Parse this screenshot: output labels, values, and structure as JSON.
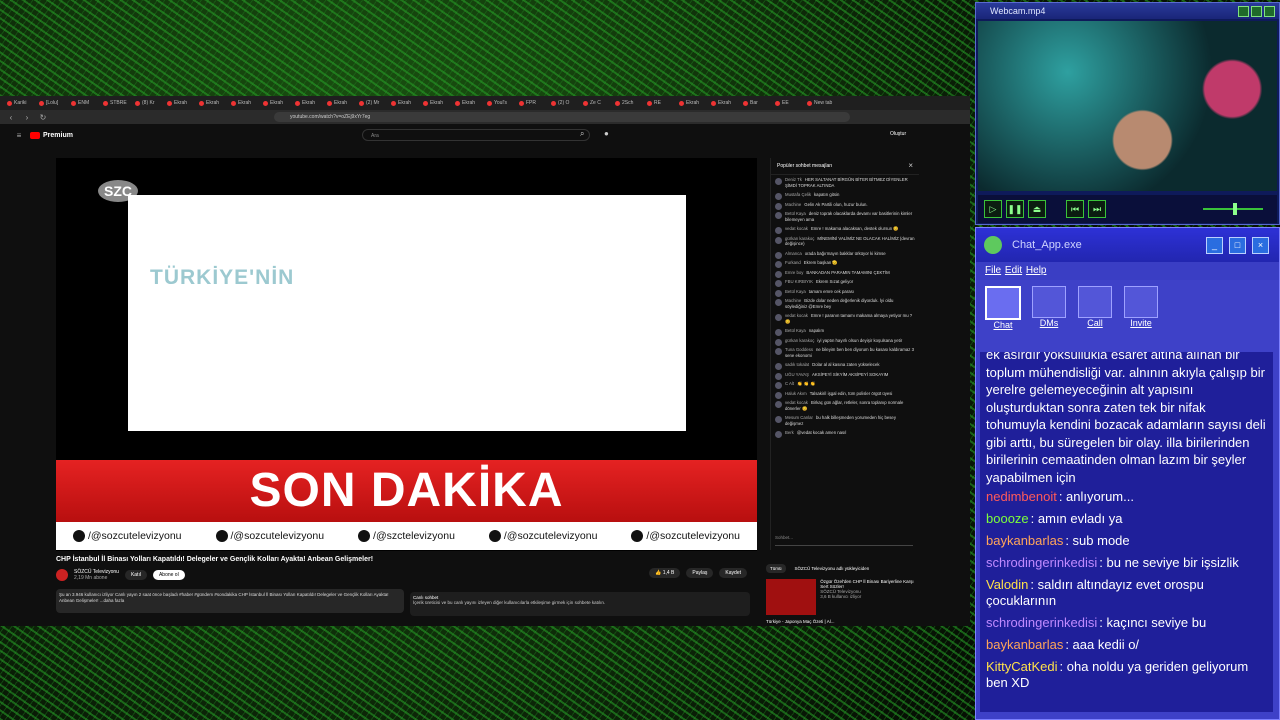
{
  "browser": {
    "url": "youtube.com/watch?v=oZEj9xYr7eg",
    "tabs": [
      "Kariki",
      "[Lolu]",
      "ENM",
      "STBRE",
      "(8) Kr",
      "Ekrah",
      "Ekrah",
      "Ekrah",
      "Ekrah",
      "Ekrah",
      "Ekrah",
      "(2) Mr",
      "Ekrah",
      "Ekrah",
      "Ekrah",
      "Youl's",
      "FPR",
      "(2) O",
      "Ze C",
      "2Sch",
      "RE",
      "Ekrah",
      "Ekrah",
      "Bar",
      "EE",
      "New tab"
    ]
  },
  "youtube": {
    "logo": "Premium",
    "search_placeholder": "Ara",
    "create_label": "Oluştur",
    "video": {
      "channel_logo": "SZC",
      "slide_text": "TÜRKİYE'NİN",
      "banner": "SON DAKİKA",
      "socials": [
        "/@sozcutelevizyonu",
        "/@sozcutelevizyonu",
        "/@szctelevizyonu",
        "/@sozcutelevizyonu",
        "/@sozcutelevizyonu"
      ]
    },
    "title": "CHP İstanbul İl Binası Yolları Kapatıldı! Delegeler ve Gençlik Kolları Ayakta! Anbean Gelişmeler!",
    "channel": "SÖZCÜ Televizyonu",
    "subs": "2,19 Mn abone",
    "join": "Katıl",
    "subscribe": "Abone ol",
    "likes": "1,4 B",
    "share": "Paylaş",
    "save": "Kaydet",
    "description": "Şu an 3.946 kullanıcı izliyor  Canlı yayın 2 saat önce başladı  #haber #gündem #sondakika CHP İstanbul İl Binası Yolları Kapatıldı! Delegeler ve Gençlik Kolları Ayakta! Anbean Gelişmeler! ...daha fazla",
    "live_chat_title": "Canlı sohbet",
    "live_chat_note": "İçerik üreticisi ve bu canlı yayını izleyen diğer kullanıcılarla etkileşime girmek için sohbete katılın."
  },
  "chat_panel": {
    "header": "Popüler sohbet mesajları",
    "messages": [
      {
        "name": "Deniz Tk",
        "text": "HER SALTANAT BİRGÜN BİTER BİTMEZ DİYENLER ŞİMDİ TOPRAK ALTINDA"
      },
      {
        "name": "Mustafa Çelik",
        "text": "kapatın gitsin"
      },
      {
        "name": "Machine",
        "text": "Gelin Ak Partili olun, huzur bulun."
      },
      {
        "name": "Betül Kaya",
        "text": "deniz toprak olacaklarda devamı var basitlerinin kimler bilemeyen ama"
      },
      {
        "name": "vedat kocak",
        "text": "Emre ! makama alacaksan, destek olursun 😊"
      },
      {
        "name": "gürkan karakoç",
        "text": "MİNEMİNİ VALİMİZ NE OLACAK HALİMİZ (devran değişince)"
      },
      {
        "name": "Almanca",
        "text": "orada bağırmayın bakklar ürküyor ki kimse"
      },
      {
        "name": "Furkand",
        "text": "Ekrem başkan 🫡"
      },
      {
        "name": "Emre boy",
        "text": "BANKADAN PARAMIN TAMAMINI ÇEKTİM"
      },
      {
        "name": "FBU KIRBIYIK",
        "text": "Ekrem Sızat geliyor"
      },
      {
        "name": "Betül Kaya",
        "text": "tamam emre cek parası"
      },
      {
        "name": "Machine",
        "text": "Bizde dolar neden değerlenik diyorduk. İyi oldu söylediğiniz @Emre bey"
      },
      {
        "name": "vedat kocak",
        "text": "Emre ! paranın tamamı makama almaya yetiyor mu ? 😊"
      },
      {
        "name": "Betül Kaya",
        "text": "napalım"
      },
      {
        "name": "gürkan karakoç",
        "text": "iyi yaptın hayırlı olsun deyişir koşulsana yetir"
      },
      {
        "name": "Tuna Goddess",
        "text": "ne bileyim ben ben diyorum bu kasası kaldıramaz 3 sene ekonomi"
      },
      {
        "name": "sadık tokalat",
        "text": "Dolar al al kasına zaten yükselecek"
      },
      {
        "name": "UĞU YAVAŞ",
        "text": "AKSİPEYİ SİKYİM AKSİPEYİ SOKAYIM"
      },
      {
        "name": "C Alt",
        "text": "👏 👏 👏"
      },
      {
        "name": "Haluk Akım",
        "text": "Talsakiriİ işgal edin, tüm polisler örgüt üyesi"
      },
      {
        "name": "vedat kocak",
        "text": "Birkaç gün ağlar, retleler, sonra toplanıp normale dönerler 😊"
      },
      {
        "name": "Mesum Canlar",
        "text": "bu halk billeşmeden yorumeden hiç besey değişmez"
      },
      {
        "name": "Berk",
        "text": "@vedat kocak amen nasıl"
      }
    ],
    "input_placeholder": "Sohbet..."
  },
  "related": {
    "tabs": [
      "Tümü",
      "SÖZCÜ Televizyonu adlı yükleyiciden"
    ],
    "item_title": "Özgür Özel'den CHP İl Binası Bariyerline Karşı Sert Sözler!",
    "item_channel": "SÖZCÜ Televizyonu",
    "item_views": "3,6 B kullanıcı izliyor",
    "next_title": "Türkiye - Japonya Maç Özeti | Al..."
  },
  "webcam": {
    "title": "Webcam.mp4",
    "controls": [
      "play-icon",
      "pause-icon",
      "eject-icon",
      "prev-icon",
      "next-icon"
    ],
    "volume": 0.5
  },
  "chat_app": {
    "title": "Chat_App.exe",
    "menu": [
      "File",
      "Edit",
      "Help"
    ],
    "tools": [
      {
        "label": "Chat",
        "icon": "chat-icon"
      },
      {
        "label": "DMs",
        "icon": "megaphone-icon"
      },
      {
        "label": "Call",
        "icon": "call-icon"
      },
      {
        "label": "Invite",
        "icon": "invite-icon"
      }
    ],
    "big_message": "ek asırdır yoksullukla esaret altına alınan bir toplum mühendisliği var. alnının akıyla çalışıp bir yerelre gelemeyeceğinin alt yapısını oluşturduktan sonra zaten tek bir nifak tohumuyla kendini bozacak adamların sayısı deli gibi arttı, bu süregelen bir olay. illa birilerinden birilerinin cemaatinden olman lazım bir şeyler yapabilmen için",
    "messages": [
      {
        "user": "nedimbenoit",
        "color": "#ff5a5a",
        "text": ": anlıyorum..."
      },
      {
        "user": "boooze",
        "color": "#7dff3a",
        "text": ": amın evladı ya"
      },
      {
        "user": "baykanbarlas",
        "color": "#ffa55a",
        "text": ": sub mode"
      },
      {
        "user": "schrodingerinkedisi",
        "color": "#c08aff",
        "text": ": bu ne seviye bir işsizlik"
      },
      {
        "user": "Valodin",
        "color": "#ffe14a",
        "text": ": saldırı altındayız evet orospu çocuklarının"
      },
      {
        "user": "schrodingerinkedisi",
        "color": "#c08aff",
        "text": ": kaçıncı seviye bu"
      },
      {
        "user": "baykanbarlas",
        "color": "#ffa55a",
        "text": ": aaa kedii o/"
      },
      {
        "user": "KittyCatKedi",
        "color": "#ffe14a",
        "text": ": oha noldu ya geriden geliyorum ben XD"
      }
    ]
  }
}
